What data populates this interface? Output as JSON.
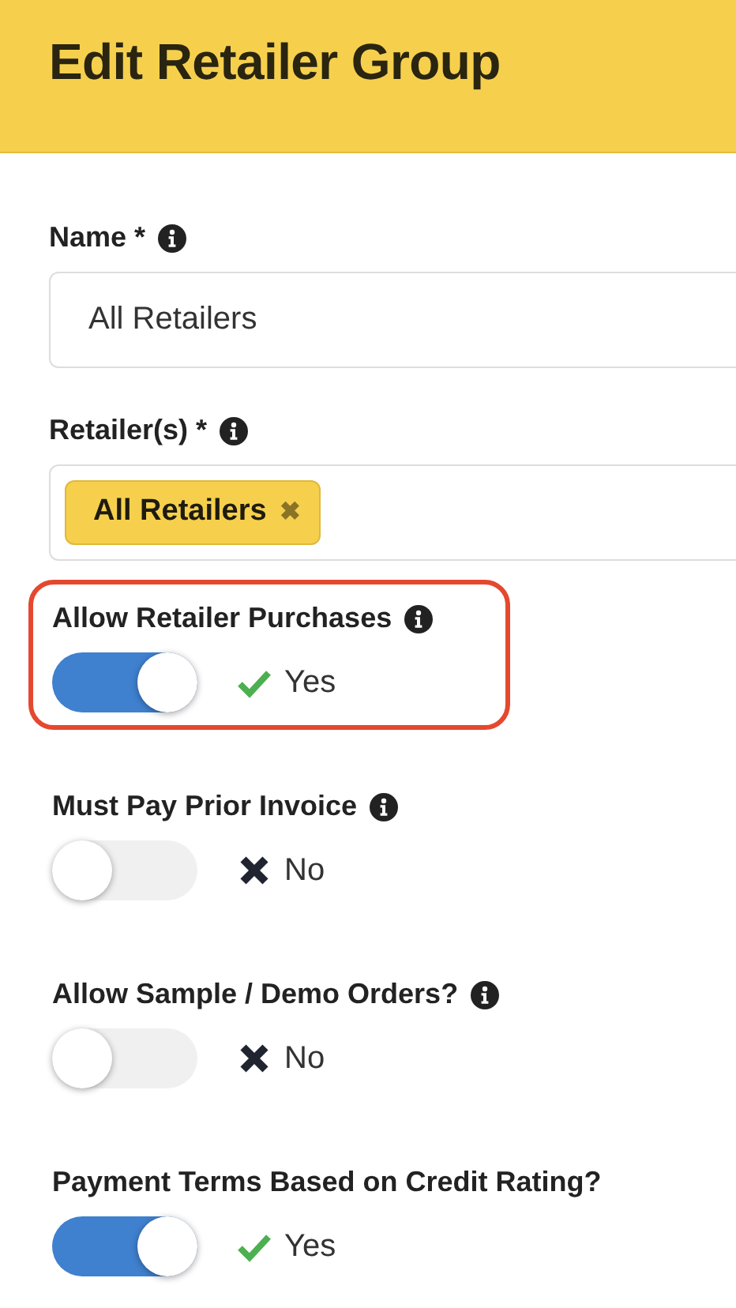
{
  "header": {
    "title": "Edit Retailer Group"
  },
  "name_field": {
    "label": "Name *",
    "info": true,
    "value": "All Retailers"
  },
  "retailers_field": {
    "label": "Retailer(s) *",
    "info": true,
    "tags": [
      {
        "label": "All Retailers",
        "remove": "✖"
      }
    ]
  },
  "toggles": [
    {
      "label": "Allow Retailer Purchases",
      "info": true,
      "on": true,
      "status": "Yes",
      "highlighted": true
    },
    {
      "label": "Must Pay Prior Invoice",
      "info": true,
      "on": false,
      "status": "No",
      "highlighted": false
    },
    {
      "label": "Allow Sample / Demo Orders?",
      "info": true,
      "on": false,
      "status": "No",
      "highlighted": false
    },
    {
      "label": "Payment Terms Based on Credit Rating?",
      "info": false,
      "on": true,
      "status": "Yes",
      "highlighted": false
    }
  ]
}
